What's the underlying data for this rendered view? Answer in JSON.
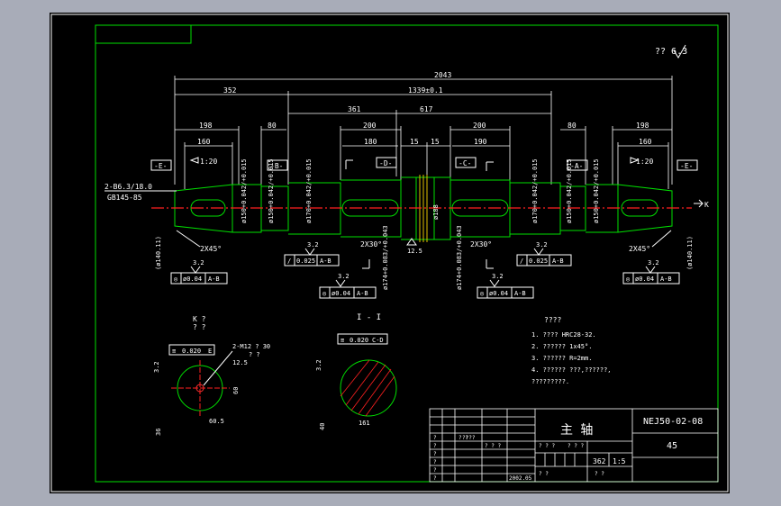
{
  "drawing": {
    "dims": {
      "overall": "2043",
      "left_seg": "352",
      "mid_span": "1339±0.1",
      "seg_361": "361",
      "seg_617": "617",
      "d198": "198",
      "d160": "160",
      "d80": "80",
      "d200": "200",
      "d180": "180",
      "d15": "15",
      "d190": "190"
    },
    "tags": {
      "E": "-E-",
      "B": "-B-",
      "D": "-D-",
      "C": "-C-",
      "A": "-A-"
    },
    "taper": "1:20",
    "center_hole": "2-B6.3/18.0",
    "center_std": "GB145-85",
    "chamfer_45": "2X45°",
    "chamfer_30": "2X30°",
    "roughness": "3.2",
    "roughness_alt": "12.5",
    "diameters": {
      "d150": "ø150+0.042/+0.015",
      "d170": "ø170+0.042/+0.015",
      "d174": "ø174+0.083/+0.043",
      "d188": "ø188",
      "d140": "(ø140.11)"
    },
    "fcf": {
      "runout_ab_left": "ø0.04",
      "runout_ab_mid": "ø0.04",
      "runout_ab_right": "ø0.04",
      "perp_ab_left": "0.025",
      "perp_ab_right": "0.025",
      "datum_ab": "A-B",
      "sym_e": "0.020",
      "datum_e": "E",
      "sym_cd": "0.020",
      "datum_cd": "C-D"
    },
    "section_k": {
      "title": "K ?",
      "subtitle": "? ?",
      "thread": "2-M12 ? 30",
      "thread_sub": "? ?",
      "dim_60": "60",
      "dim_605": "60.5",
      "dim_36": "36",
      "dim_32": "3.2"
    },
    "section_i": {
      "title": "I - I",
      "dim_161": "161",
      "dim_40": "40",
      "dim_32": "3.2"
    },
    "k_marker": "K",
    "notes": {
      "heading": "????",
      "lines": [
        "1. ???? HRC28-32.",
        "2. ?????? 1x45°.",
        "3. ?????? R=2mm.",
        "4. ?????? ???,??????,",
        "   ?????????."
      ]
    },
    "top_right": "?? 6.3",
    "title_block": {
      "part_name": "主   轴",
      "drawing_no": "NEJ50-02-08",
      "material": "45",
      "scale": "1:5",
      "weight": "362",
      "date": "2002.05",
      "q1": "?",
      "q2": "? ?",
      "q3": "????",
      "q4": "? ? ?"
    }
  }
}
